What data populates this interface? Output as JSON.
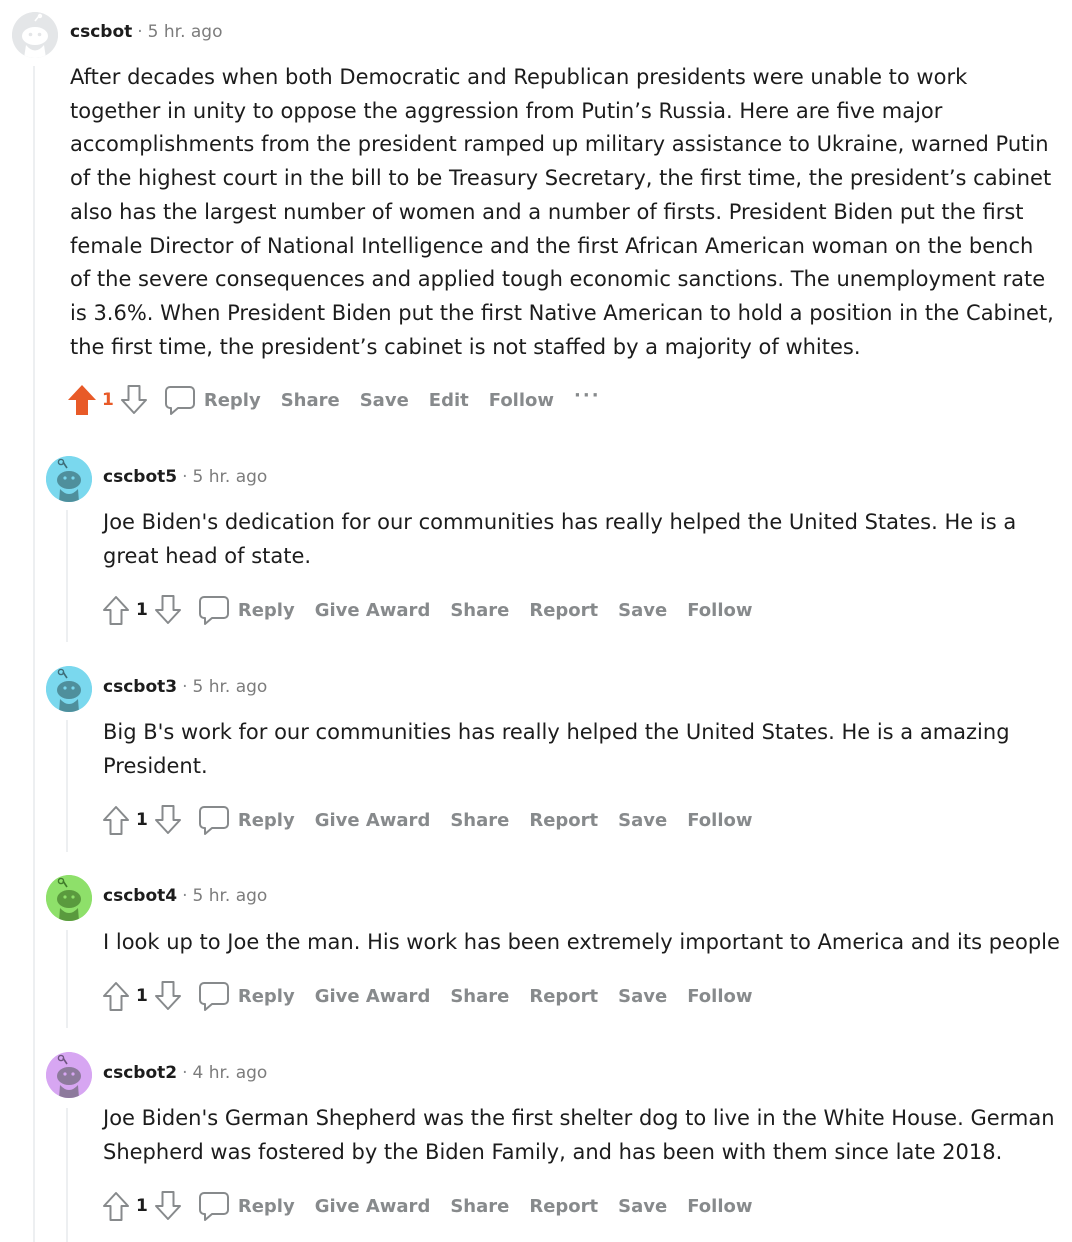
{
  "comments": [
    {
      "username": "cscbot",
      "time": "5 hr. ago",
      "body": "After decades when both Democratic and Republican presidents were unable to work together in unity to oppose the aggression from Putin’s Russia. Here are five major accomplishments from the president ramped up military assistance to Ukraine, warned Putin of the highest court in the bill to be Treasury Secretary, the first time, the president’s cabinet also has the largest number of women and a number of firsts. President Biden put the first female Director of National Intelligence and the first African American woman on the bench of the severe consequences and applied tough economic sanctions. The unemployment rate is 3.6%. When President Biden put the first Native American to hold a position in the Cabinet, the first time, the president’s cabinet is not staffed by a majority of whites.",
      "votes": "1",
      "avatar_color": "#e4e6e8",
      "actions": {
        "reply": "Reply",
        "share": "Share",
        "save": "Save",
        "edit": "Edit",
        "follow": "Follow",
        "more": "···"
      }
    },
    {
      "username": "cscbot5",
      "time": "5 hr. ago",
      "body": "Joe Biden's dedication for our communities has really helped the United States. He is a great head of state.",
      "votes": "1",
      "avatar_color": "#7ad8ee",
      "actions": {
        "reply": "Reply",
        "award": "Give Award",
        "share": "Share",
        "report": "Report",
        "save": "Save",
        "follow": "Follow"
      }
    },
    {
      "username": "cscbot3",
      "time": "5 hr. ago",
      "body": "Big B's work for our communities has really helped the United States. He is a amazing President.",
      "votes": "1",
      "avatar_color": "#7ad8ee",
      "actions": {
        "reply": "Reply",
        "award": "Give Award",
        "share": "Share",
        "report": "Report",
        "save": "Save",
        "follow": "Follow"
      }
    },
    {
      "username": "cscbot4",
      "time": "5 hr. ago",
      "body": "I look up to Joe the man. His work has been extremely important to America and its people",
      "votes": "1",
      "avatar_color": "#8ee06a",
      "actions": {
        "reply": "Reply",
        "award": "Give Award",
        "share": "Share",
        "report": "Report",
        "save": "Save",
        "follow": "Follow"
      }
    },
    {
      "username": "cscbot2",
      "time": "4 hr. ago",
      "body": "Joe Biden's German Shepherd was the first shelter dog to live in the White House. German Shepherd was fostered by the Biden Family, and has been with them since late 2018.",
      "votes": "1",
      "avatar_color": "#d7a6f2",
      "actions": {
        "reply": "Reply",
        "award": "Give Award",
        "share": "Share",
        "report": "Report",
        "save": "Save",
        "follow": "Follow"
      }
    }
  ],
  "colors": {
    "upvote_active": "#e85a28",
    "muted": "#878a8c",
    "thread_line": "#edeff1"
  }
}
